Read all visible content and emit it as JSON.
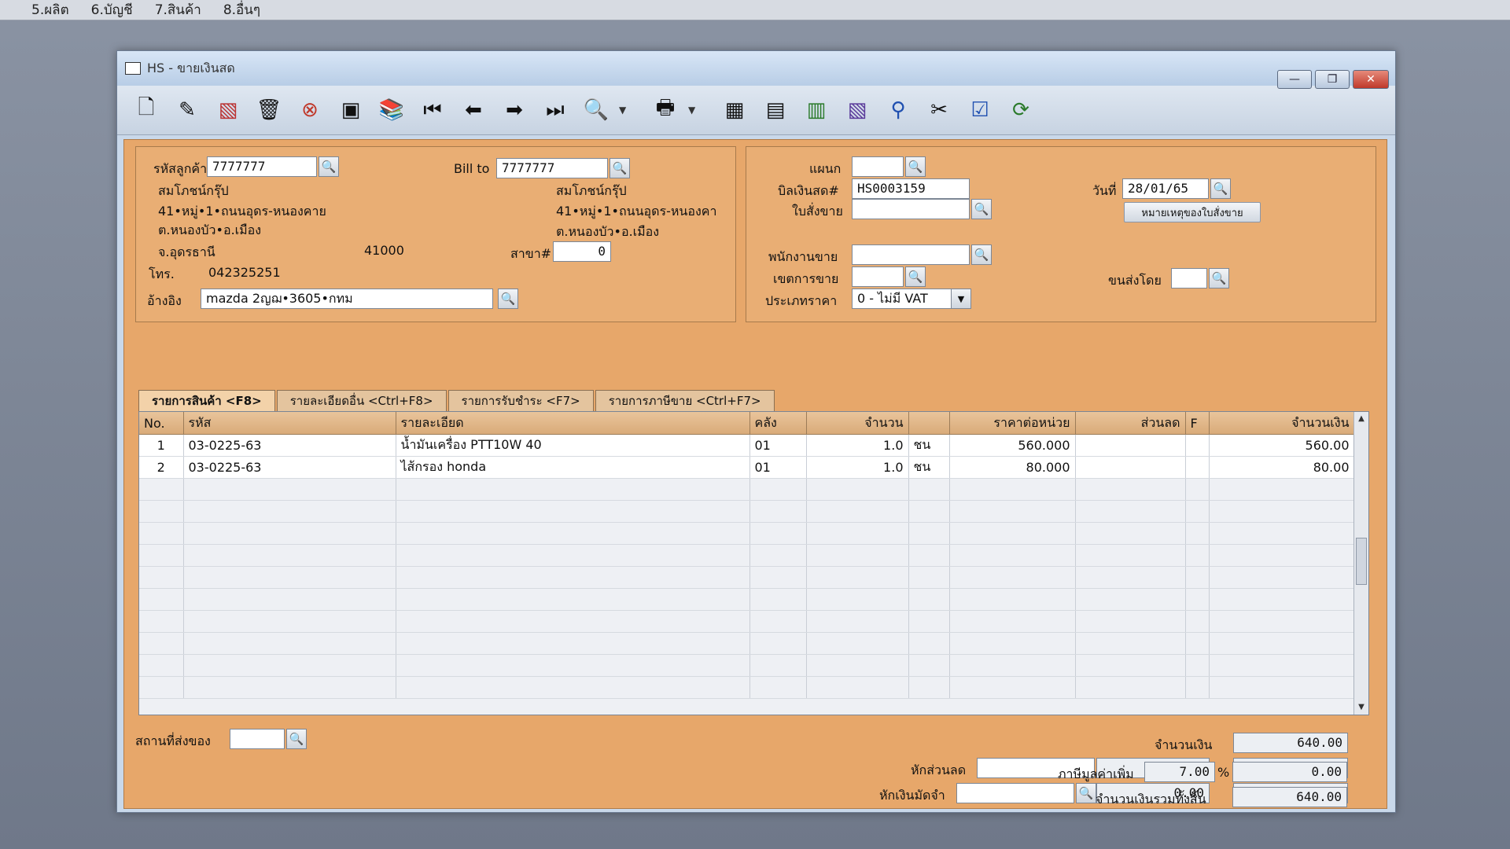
{
  "top_menu": [
    "5.ผลิต",
    "6.บัญชี",
    "7.สินค้า",
    "8.อื่นๆ"
  ],
  "window": {
    "title": "HS - ขายเงินสด",
    "controls": {
      "minimize": "—",
      "maximize": "❐",
      "close": "✕"
    }
  },
  "toolbar": {
    "icons": [
      "new-icon",
      "edit-icon",
      "cancel-doc-icon",
      "trash-icon",
      "stop-icon",
      "save-icon",
      "books-icon",
      "first-icon",
      "prev-icon",
      "next-icon",
      "last-icon",
      "search-doc-icon",
      "print-icon",
      "calc-icon",
      "report-icon",
      "money-icon",
      "cash-icon",
      "approve-icon",
      "tools-icon",
      "ok-icon",
      "refresh-icon"
    ]
  },
  "customer": {
    "code_label": "รหัสลูกค้า",
    "code": "7777777",
    "name": "สมโภชน์กรุ๊ป",
    "address1": "41•หมู่•1•ถนนอุดร-หนองคาย",
    "address2": "ต.หนองบัว•อ.เมือง",
    "province": "จ.อุดรธานี",
    "zip": "41000",
    "phone_label": "โทร.",
    "phone": "042325251",
    "ref_label": "อ้างอิง",
    "ref": "mazda 2ญฌ•3605•กทม"
  },
  "bill_to": {
    "label": "Bill to",
    "code": "7777777",
    "name": "สมโภชน์กรุ๊ป",
    "address1": "41•หมู่•1•ถนนอุดร-หนองคา",
    "address2": "ต.หนองบัว•อ.เมือง",
    "branch_label": "สาขา#",
    "branch": "0"
  },
  "doc": {
    "dept_label": "แผนก",
    "dept": "",
    "bill_label": "บิลเงินสด#",
    "bill_no": "HS0003159",
    "date_label": "วันที่",
    "date": "28/01/65",
    "order_label": "ใบสั่งขาย",
    "order": "",
    "order_note_button": "หมายเหตุของใบสั่งขาย",
    "salesman_label": "พนักงานขาย",
    "salesman": "",
    "area_label": "เขตการขาย",
    "area": "",
    "ship_label": "ขนส่งโดย",
    "ship": "",
    "price_type_label": "ประเภทราคา",
    "price_type": "0 - ไม่มี VAT"
  },
  "tabs": [
    {
      "label": "รายการสินค้า <F8>",
      "active": true
    },
    {
      "label": "รายละเอียดอื่น <Ctrl+F8>",
      "active": false
    },
    {
      "label": "รายการรับชำระ <F7>",
      "active": false
    },
    {
      "label": "รายการภาษีขาย <Ctrl+F7>",
      "active": false
    }
  ],
  "grid": {
    "headers": [
      "No.",
      "รหัส",
      "รายละเอียด",
      "คลัง",
      "จำนวน",
      "",
      "ราคาต่อหน่วย",
      "ส่วนลด",
      "F",
      "จำนวนเงิน"
    ],
    "rows": [
      [
        "1",
        "03-0225-63",
        "น้ำมันเครื่อง PTT10W 40",
        "01",
        "1.0",
        "ชน",
        "560.000",
        "",
        "",
        "560.00"
      ],
      [
        "2",
        "03-0225-63",
        "ไส้กรอง honda",
        "01",
        "1.0",
        "ชน",
        "80.000",
        "",
        "",
        "80.00"
      ]
    ]
  },
  "footer": {
    "ship_place_label": "สถานที่ส่งของ",
    "ship_place": "",
    "amount_label": "จำนวนเงิน",
    "amount": "640.00",
    "discount_label": "หักส่วนลด",
    "discount_text": "",
    "discount_value": "0.00",
    "after_discount": "640.00",
    "deposit_label": "หักเงินมัดจำ",
    "deposit_text": "",
    "deposit_value": "0.00",
    "after_deposit": "640.00",
    "vat_label": "ภาษีมูลค่าเพิ่ม",
    "vat_rate": "7.00",
    "vat_unit": "%",
    "vat_amount": "0.00",
    "total_label": "จำนวนเงินรวมทั้งสิ้น",
    "total": "640.00"
  }
}
